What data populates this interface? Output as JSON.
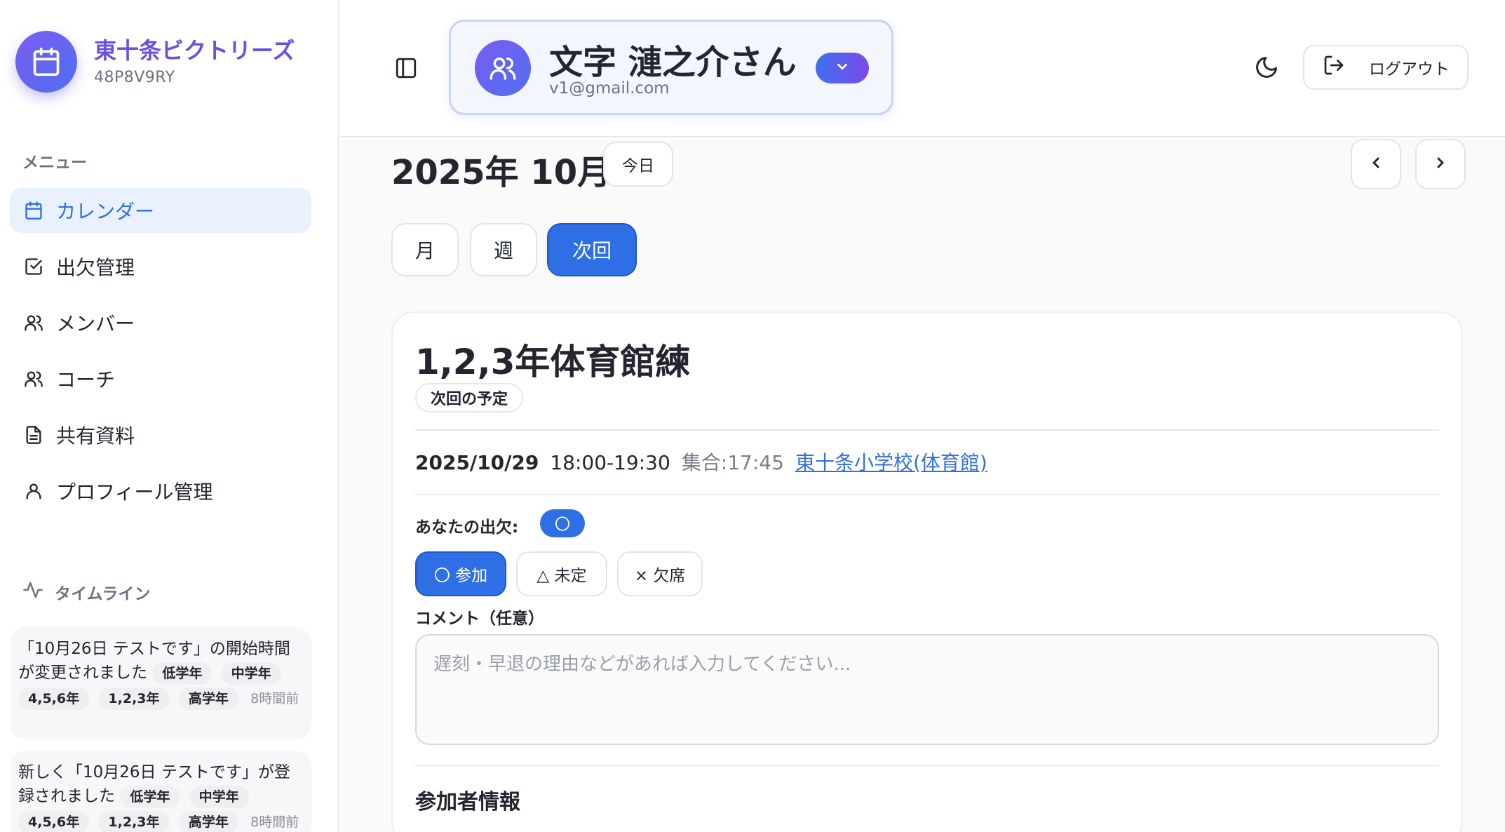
{
  "sidebar": {
    "brand_name": "東十条ビクトリーズ",
    "brand_code": "48P8V9RY",
    "menu_label": "メニュー",
    "items": [
      {
        "label": "カレンダー",
        "icon": "calendar-icon",
        "active": true
      },
      {
        "label": "出欠管理",
        "icon": "checkbox-icon"
      },
      {
        "label": "メンバー",
        "icon": "users-icon"
      },
      {
        "label": "コーチ",
        "icon": "users-icon"
      },
      {
        "label": "共有資料",
        "icon": "document-icon"
      },
      {
        "label": "プロフィール管理",
        "icon": "user-icon"
      }
    ],
    "timeline_label": "タイムライン",
    "timeline": [
      {
        "text": "「10月26日 テストです」の開始時間が変更されました",
        "tags": [
          "低学年",
          "中学年",
          "4,5,6年",
          "1,2,3年",
          "高学年"
        ],
        "time": "8時間前"
      },
      {
        "text": "新しく「10月26日 テストです」が登録されました",
        "tags": [
          "低学年",
          "中学年",
          "4,5,6年",
          "1,2,3年",
          "高学年"
        ],
        "time": "8時間前"
      }
    ]
  },
  "header": {
    "user_name": "文字 漣之介さん",
    "user_email": "v1@gmail.com",
    "logout_label": "ログアウト"
  },
  "calendar": {
    "month_title": "2025年 10月",
    "today_label": "今日",
    "tabs": [
      "月",
      "週",
      "次回"
    ],
    "active_tab": "次回"
  },
  "event": {
    "title": "1,2,3年体育館練",
    "badge": "次回の予定",
    "date": "2025/10/29",
    "time": "18:00-19:30",
    "gather": "集合:17:45",
    "place": "東十条小学校(体育館)",
    "attendance_label": "あなたの出欠:",
    "attendance_value": "〇",
    "buttons": {
      "attend": "〇 参加",
      "undecided": "△ 未定",
      "absent": "× 欠席"
    },
    "comment_label": "コメント（任意）",
    "comment_placeholder": "遅刻・早退の理由などがあれば入力してください...",
    "participants_title": "参加者情報"
  },
  "colors": {
    "accent": "#2f6fe6",
    "brand_purple": "#6a4fe0"
  }
}
